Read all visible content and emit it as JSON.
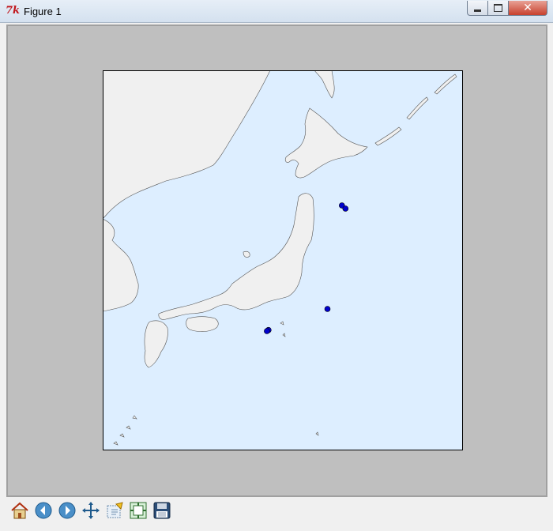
{
  "window": {
    "title": "Figure 1",
    "app_icon": "tk-icon",
    "close_glyph": "✕"
  },
  "toolbar": {
    "buttons": [
      {
        "name": "home",
        "icon": "home-icon"
      },
      {
        "name": "back",
        "icon": "back-arrow-icon"
      },
      {
        "name": "forward",
        "icon": "forward-arrow-icon"
      },
      {
        "name": "pan",
        "icon": "pan-icon"
      },
      {
        "name": "zoom",
        "icon": "zoom-icon"
      },
      {
        "name": "configure-subplots",
        "icon": "subplots-icon"
      },
      {
        "name": "save",
        "icon": "save-icon"
      }
    ]
  },
  "map": {
    "region": "Japan",
    "ocean_color": "#ddeeff",
    "land_color": "#f0f0f0",
    "marker_color": "#0000cc",
    "lon_range": [
      124,
      149
    ],
    "lat_range": [
      29,
      47
    ],
    "points": [
      {
        "lon": 140.6,
        "lat": 40.6
      },
      {
        "lon": 140.85,
        "lat": 40.45
      },
      {
        "lon": 139.6,
        "lat": 35.7
      },
      {
        "lon": 135.5,
        "lat": 34.7
      },
      {
        "lon": 135.4,
        "lat": 34.65
      }
    ]
  }
}
